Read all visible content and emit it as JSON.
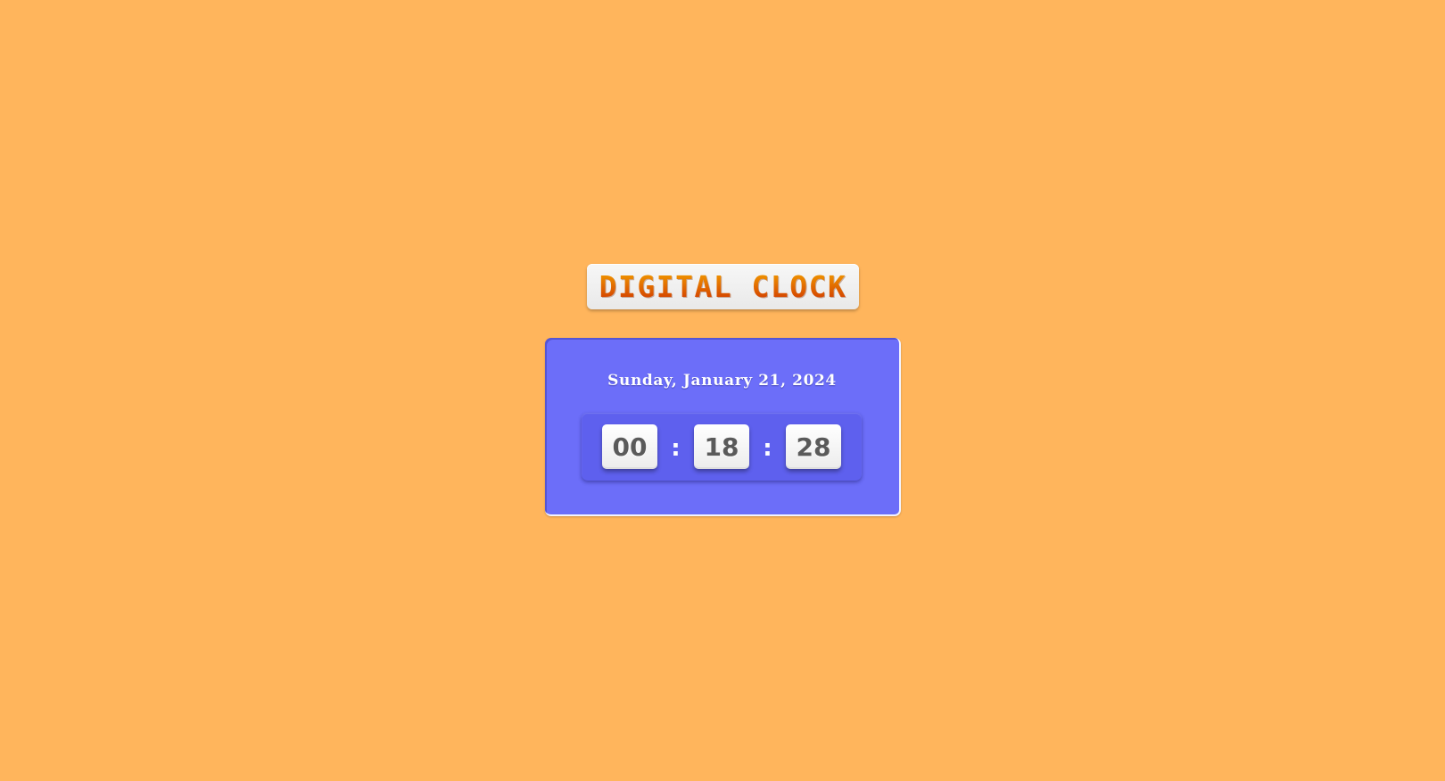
{
  "colors": {
    "background": "#FFB55C",
    "card": "#6C6EF9",
    "time_panel": "#5E60EE",
    "title_gradient_top": "#F29A00",
    "title_gradient_bottom": "#D13A00",
    "digit_text": "#5A5A5A"
  },
  "title": "Digital Clock",
  "clock": {
    "date": "Sunday, January 21, 2024",
    "hours": "00",
    "minutes": "18",
    "seconds": "28",
    "separator": ":"
  }
}
